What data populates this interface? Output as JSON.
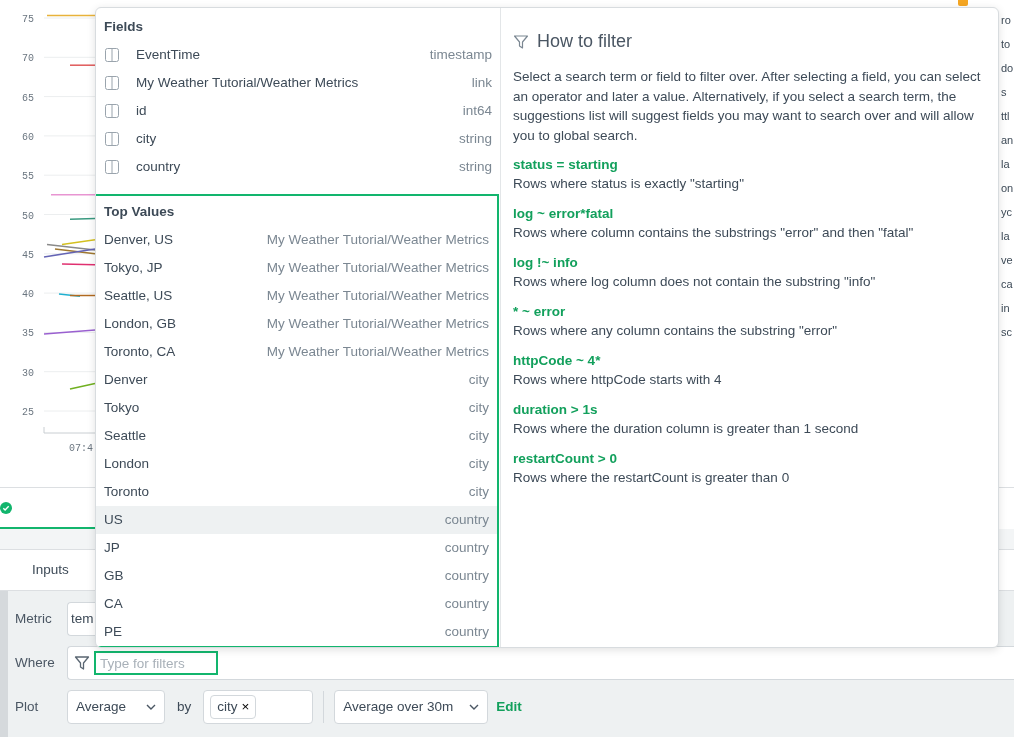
{
  "chart": {
    "y_axis_labels": [
      "75",
      "70",
      "65",
      "60",
      "55",
      "50",
      "45",
      "40",
      "35",
      "30",
      "25"
    ],
    "x_axis_labels": [
      "07:4"
    ],
    "legend": [
      {
        "color": "#f5a623"
      }
    ],
    "legend_cut_labels": [
      "ro",
      "to",
      "do",
      "s",
      "ttl",
      "an",
      "la",
      "on",
      "yc",
      "la",
      "ve",
      "ca",
      "in",
      "sc"
    ]
  },
  "tabs": [
    {
      "label": "Inputs",
      "selected": false
    }
  ],
  "query": {
    "metric": {
      "label": "Metric",
      "value": "tem"
    },
    "where": {
      "label": "Where",
      "placeholder": "Type for filters",
      "highlighted": true
    },
    "plot": {
      "label": "Plot",
      "aggregate": "Average",
      "by_label": "by",
      "group_tags": [
        {
          "label": "city",
          "remove": "×"
        }
      ],
      "window": "Average over 30m",
      "edit": "Edit"
    }
  },
  "dropdown": {
    "fields_heading": "Fields",
    "fields": [
      {
        "name": "EventTime",
        "type": "timestamp"
      },
      {
        "name": "My Weather Tutorial/Weather Metrics",
        "type": "link"
      },
      {
        "name": "id",
        "type": "int64"
      },
      {
        "name": "city",
        "type": "string"
      },
      {
        "name": "country",
        "type": "string"
      }
    ],
    "top_values_heading": "Top Values",
    "top_values_highlighted": true,
    "top_values": [
      {
        "value": "Denver, US",
        "source": "My Weather Tutorial/Weather Metrics",
        "selected": false
      },
      {
        "value": "Tokyo, JP",
        "source": "My Weather Tutorial/Weather Metrics",
        "selected": false
      },
      {
        "value": "Seattle, US",
        "source": "My Weather Tutorial/Weather Metrics",
        "selected": false
      },
      {
        "value": "London, GB",
        "source": "My Weather Tutorial/Weather Metrics",
        "selected": false
      },
      {
        "value": "Toronto, CA",
        "source": "My Weather Tutorial/Weather Metrics",
        "selected": false
      },
      {
        "value": "Denver",
        "source": "city",
        "selected": false
      },
      {
        "value": "Tokyo",
        "source": "city",
        "selected": false
      },
      {
        "value": "Seattle",
        "source": "city",
        "selected": false
      },
      {
        "value": "London",
        "source": "city",
        "selected": false
      },
      {
        "value": "Toronto",
        "source": "city",
        "selected": false
      },
      {
        "value": "US",
        "source": "country",
        "selected": true
      },
      {
        "value": "JP",
        "source": "country",
        "selected": false
      },
      {
        "value": "GB",
        "source": "country",
        "selected": false
      },
      {
        "value": "CA",
        "source": "country",
        "selected": false
      },
      {
        "value": "PE",
        "source": "country",
        "selected": false
      }
    ],
    "help": {
      "title": "How to filter",
      "intro": "Select a search term or field to filter over. After selecting a field, you can select an operator and later a value. Alternatively, if you select a search term, the suggestions list will suggest fields you may want to search over and will allow you to global search.",
      "examples": [
        {
          "expression": "status = starting",
          "description": "Rows where status is exactly \"starting\""
        },
        {
          "expression": "log ~ error*fatal",
          "description": "Rows where column contains the substrings \"error\" and then \"fatal\""
        },
        {
          "expression": "log !~ info",
          "description": "Rows where log column does not contain the substring \"info\""
        },
        {
          "expression": "* ~ error",
          "description": "Rows where any column contains the substring \"error\""
        },
        {
          "expression": "httpCode ~ 4*",
          "description": "Rows where httpCode starts with 4"
        },
        {
          "expression": "duration > 1s",
          "description": "Rows where the duration column is greater than 1 second"
        },
        {
          "expression": "restartCount > 0",
          "description": "Rows where the restartCount is greater than 0"
        }
      ]
    }
  }
}
